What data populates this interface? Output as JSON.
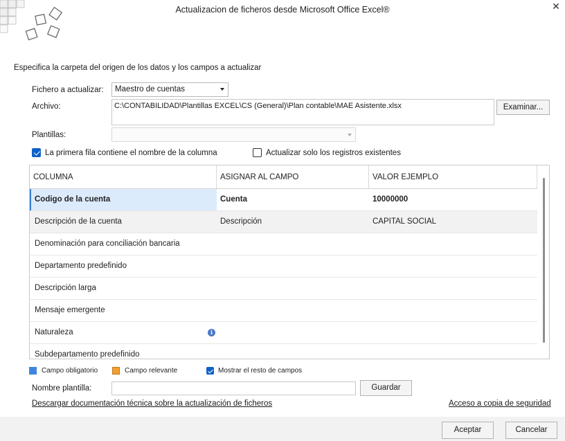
{
  "window": {
    "title": "Actualizacion de ficheros desde Microsoft Office Excel®",
    "close_glyph": "✕"
  },
  "subtitle": "Especifica la carpeta del origen de los datos y los campos a actualizar",
  "form": {
    "fichero_label": "Fichero a actualizar:",
    "fichero_value": "Maestro de cuentas",
    "archivo_label": "Archivo:",
    "archivo_value": "C:\\CONTABILIDAD\\Plantillas EXCEL\\CS (General)\\Plan contable\\MAE Asistente.xlsx",
    "examinar_label": "Examinar...",
    "plantillas_label": "Plantillas:",
    "plantillas_value": ""
  },
  "options": {
    "primera_fila_label": "La primera fila contiene el nombre de la columna",
    "primera_fila_checked": true,
    "solo_existentes_label": "Actualizar solo los registros existentes",
    "solo_existentes_checked": false
  },
  "grid": {
    "headers": [
      "COLUMNA",
      "ASIGNAR AL CAMPO",
      "VALOR EJEMPLO"
    ],
    "rows": [
      {
        "columna": "Codigo de la cuenta",
        "campo": "Cuenta",
        "valor": "10000000"
      },
      {
        "columna": "Descripción de la cuenta",
        "campo": "Descripción",
        "valor": "CAPITAL SOCIAL"
      },
      {
        "columna": "Denominación para conciliación bancaria",
        "campo": "",
        "valor": ""
      },
      {
        "columna": "Departamento predefinido",
        "campo": "",
        "valor": ""
      },
      {
        "columna": "Descripción larga",
        "campo": "",
        "valor": ""
      },
      {
        "columna": "Mensaje emergente",
        "campo": "",
        "valor": ""
      },
      {
        "columna": "Naturaleza",
        "campo": "",
        "valor": ""
      },
      {
        "columna": "Subdepartamento predefinido",
        "campo": "",
        "valor": ""
      }
    ],
    "info_glyph": "i"
  },
  "legend": {
    "obligatorio_label": "Campo obligatorio",
    "obligatorio_color": "#3d85e0",
    "relevante_label": "Campo relevante",
    "relevante_color": "#f0a030",
    "mostrar_resto_label": "Mostrar el resto de campos",
    "mostrar_resto_checked": true
  },
  "nombre_plantilla": {
    "label": "Nombre plantilla:",
    "value": "",
    "guardar_label": "Guardar"
  },
  "links": {
    "documentacion": "Descargar documentación técnica sobre la actualización de ficheros",
    "copia_seguridad": "Acceso a copia de seguridad"
  },
  "footer": {
    "aceptar_label": "Aceptar",
    "cancelar_label": "Cancelar"
  }
}
